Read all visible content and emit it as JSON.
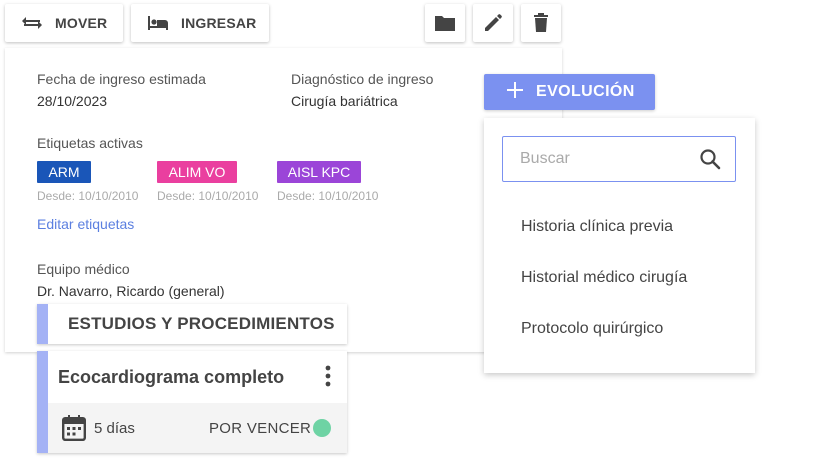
{
  "toolbar": {
    "move_label": "MOVER",
    "admit_label": "INGRESAR"
  },
  "details": {
    "admission_date_label": "Fecha de ingreso estimada",
    "admission_date_value": "28/10/2023",
    "diagnosis_label": "Diagnóstico de ingreso",
    "diagnosis_value": "Cirugía bariátrica",
    "tags_label": "Etiquetas activas",
    "tags": [
      {
        "text": "ARM",
        "since": "Desde: 10/10/2010",
        "color": "#1a56b8"
      },
      {
        "text": "ALIM VO",
        "since": "Desde: 10/10/2010",
        "color": "#ea3f9f"
      },
      {
        "text": "AISL KPC",
        "since": "Desde: 10/10/2010",
        "color": "#9b45d8"
      }
    ],
    "edit_tags_label": "Editar etiquetas",
    "team_label": "Equipo médico",
    "team_value": "Dr. Navarro, Ricardo (general)"
  },
  "evolution_button": {
    "label": "EVOLUCIÓN"
  },
  "dropdown": {
    "search_placeholder": "Buscar",
    "items": [
      "Historia clínica previa",
      "Historial médico cirugía",
      "Protocolo quirúrgico"
    ]
  },
  "studies": {
    "header": "ESTUDIOS Y PROCEDIMIENTOS",
    "card": {
      "title": "Ecocardiograma completo",
      "days": "5 días",
      "status": "POR VENCER",
      "status_color": "#6ed3a4"
    }
  },
  "colors": {
    "accent": "#7b91f0",
    "accent_light": "#a4b2f5",
    "link": "#5b7fe0"
  }
}
